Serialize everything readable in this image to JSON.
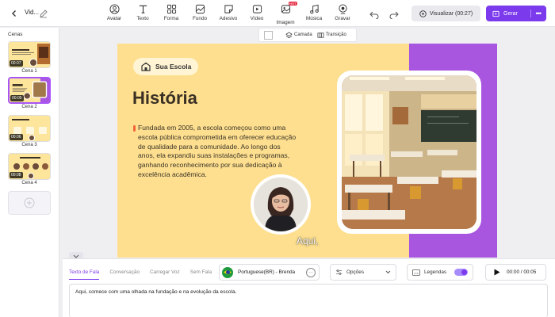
{
  "header": {
    "project_title": "Vid...",
    "tools": [
      {
        "label": "Avatar",
        "icon": "avatar-icon"
      },
      {
        "label": "Texto",
        "icon": "text-icon"
      },
      {
        "label": "Forma",
        "icon": "shapes-icon"
      },
      {
        "label": "Fundo",
        "icon": "background-icon"
      },
      {
        "label": "Adesivo",
        "icon": "sticker-icon"
      },
      {
        "label": "Vídeo",
        "icon": "video-icon"
      },
      {
        "label": "Imagem",
        "icon": "image-icon",
        "badge": "HOT"
      },
      {
        "label": "Música",
        "icon": "music-icon"
      },
      {
        "label": "Gravar",
        "icon": "record-icon"
      }
    ],
    "preview_label": "Visualizar (00:27)",
    "generate_label": "Gerar",
    "accent": "#7c3aed"
  },
  "sidebar": {
    "title": "Cenas",
    "scenes": [
      {
        "label": "Cena 1",
        "duration": "00:07",
        "thumb_heading": "Perfil da Escola"
      },
      {
        "label": "Cena 2",
        "duration": "00:05"
      },
      {
        "label": "Cena 3",
        "duration": "00:06",
        "thumb_heading": "Missão & Valores"
      },
      {
        "label": "Cena 4",
        "duration": "00:08",
        "thumb_heading": "Estrutura Organizacional"
      }
    ]
  },
  "canvas_toolbar": {
    "layer_label": "Camada",
    "transition_label": "Transição"
  },
  "slide": {
    "badge": "Sua Escola",
    "title": "História",
    "body": "Fundada em 2005, a escola começou como uma escola pública comprometida em oferecer educação de qualidade para a comunidade. Ao longo dos anos, ela expandiu suas instalações e programas, ganhando reconhecimento por sua dedicação à excelência acadêmica.",
    "caption": "Aqui,",
    "colors": {
      "background": "#fddf8f",
      "panel": "#a855e0"
    }
  },
  "bottom_panel": {
    "tabs": [
      "Texto de Fala",
      "Conversação",
      "Carregar Voz",
      "Sem Fala"
    ],
    "active_tab": "Texto de Fala",
    "voice": "Portuguese(BR) - Brenda",
    "options_label": "Opções",
    "subtitles_label": "Legendas",
    "subtitles_enabled": true,
    "time": "00:00 / 00:05",
    "script": "Aqui, comece com uma olhada na fundação e na evolução da escola."
  }
}
